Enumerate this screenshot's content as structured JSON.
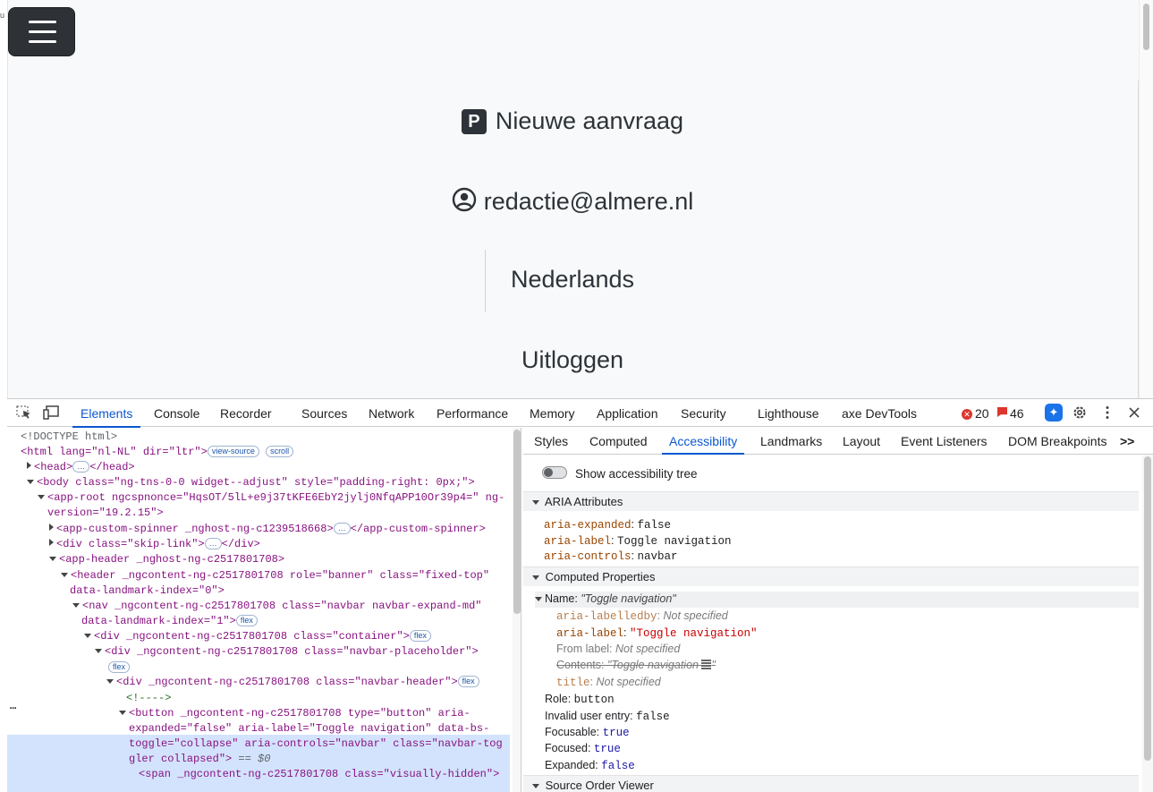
{
  "page": {
    "nav_links": {
      "new_request": "Nieuwe aanvraag",
      "new_request_badge": "P",
      "user_email": "redactie@almere.nl",
      "language": "Nederlands",
      "logout": "Uitloggen"
    },
    "toggle_label": "Toggle navigation"
  },
  "devtools": {
    "main_tabs": [
      "Elements",
      "Console",
      "Recorder",
      "Sources",
      "Network",
      "Performance",
      "Memory",
      "Application",
      "Security",
      "Lighthouse",
      "axe DevTools"
    ],
    "active_main_tab": "Elements",
    "error_count": "20",
    "warning_count": "46",
    "side_tabs": [
      "Styles",
      "Computed",
      "Accessibility",
      "Landmarks",
      "Layout",
      "Event Listeners",
      "DOM Breakpoints"
    ],
    "active_side_tab": "Accessibility",
    "more_tabs": ">>",
    "dom_tree": {
      "doctype": "<!DOCTYPE html>",
      "html_open": "<html lang=\"nl-NL\" dir=\"ltr\">",
      "view_source_pill": "view-source",
      "scroll_pill": "scroll",
      "head": "<head>",
      "head_close": "</head>",
      "ellipsis": "…",
      "body": "<body class=\"ng-tns-0-0 widget--adjust\" style=\"padding-right: 0px;\">",
      "app_root_1": "<app-root ngcspnonce=\"HqsOT/5lL+e9j37tKFE6EbY2jylj0NfqAPP10Or39p4=\" ng-",
      "app_root_2": "version=\"19.2.15\">",
      "spinner": "<app-custom-spinner _nghost-ng-c1239518668>",
      "spinner_close": "</app-custom-spinner>",
      "skip_link": "<div class=\"skip-link\">",
      "skip_link_close": "</div>",
      "app_header": "<app-header _nghost-ng-c2517801708>",
      "header_1": "<header _ngcontent-ng-c2517801708 role=\"banner\" class=\"fixed-top\"",
      "header_2": "data-landmark-index=\"0\">",
      "nav_1": "<nav _ngcontent-ng-c2517801708 class=\"navbar navbar-expand-md\"",
      "nav_2": "data-landmark-index=\"1\">",
      "container": "<div _ngcontent-ng-c2517801708 class=\"container\">",
      "placeholder": "<div _ngcontent-ng-c2517801708 class=\"navbar-placeholder\">",
      "navbar_header": "<div _ngcontent-ng-c2517801708 class=\"navbar-header\">",
      "comment": "<!---->",
      "button_1": "<button _ngcontent-ng-c2517801708 type=\"button\" aria-",
      "button_2": "expanded=\"false\" aria-label=\"Toggle navigation\" data-bs-",
      "button_3": "toggle=\"collapse\" aria-controls=\"navbar\" class=\"navbar-tog",
      "button_4": "gler collapsed\">",
      "dollar0": "== $0",
      "span": "<span _ngcontent-ng-c2517801708 class=\"visually-hidden\">",
      "flex": "flex",
      "row_dots": "…"
    },
    "accessibility": {
      "show_tree_label": "Show accessibility tree",
      "aria_section": "ARIA Attributes",
      "aria_expanded_key": "aria-expanded",
      "aria_expanded_val": "false",
      "aria_label_key": "aria-label",
      "aria_label_val": "Toggle navigation",
      "aria_controls_key": "aria-controls",
      "aria_controls_val": "navbar",
      "computed_section": "Computed Properties",
      "name_key": "Name:",
      "name_val": "\"Toggle navigation\"",
      "labelledby_key": "aria-labelledby",
      "labelledby_val": "Not specified",
      "label_key": "aria-label",
      "label_val": "\"Toggle navigation\"",
      "from_label_key": "From label:",
      "from_label_val": "Not specified",
      "contents_key": "Contents:",
      "contents_val": "\"Toggle navigation ",
      "contents_end": "\"",
      "title_key": "title",
      "title_val": "Not specified",
      "role_key": "Role:",
      "role_val": "button",
      "invalid_key": "Invalid user entry:",
      "invalid_val": "false",
      "focusable_key": "Focusable:",
      "focusable_val": "true",
      "focused_key": "Focused:",
      "focused_val": "true",
      "expanded_key": "Expanded:",
      "expanded_val": "false",
      "source_order_section": "Source Order Viewer"
    }
  },
  "colors": {
    "accent": "#0b57d0",
    "tag": "#881280",
    "attr": "#994500",
    "value": "#1a1aa6",
    "selection": "#d3e3fd",
    "error": "#dc362e"
  }
}
